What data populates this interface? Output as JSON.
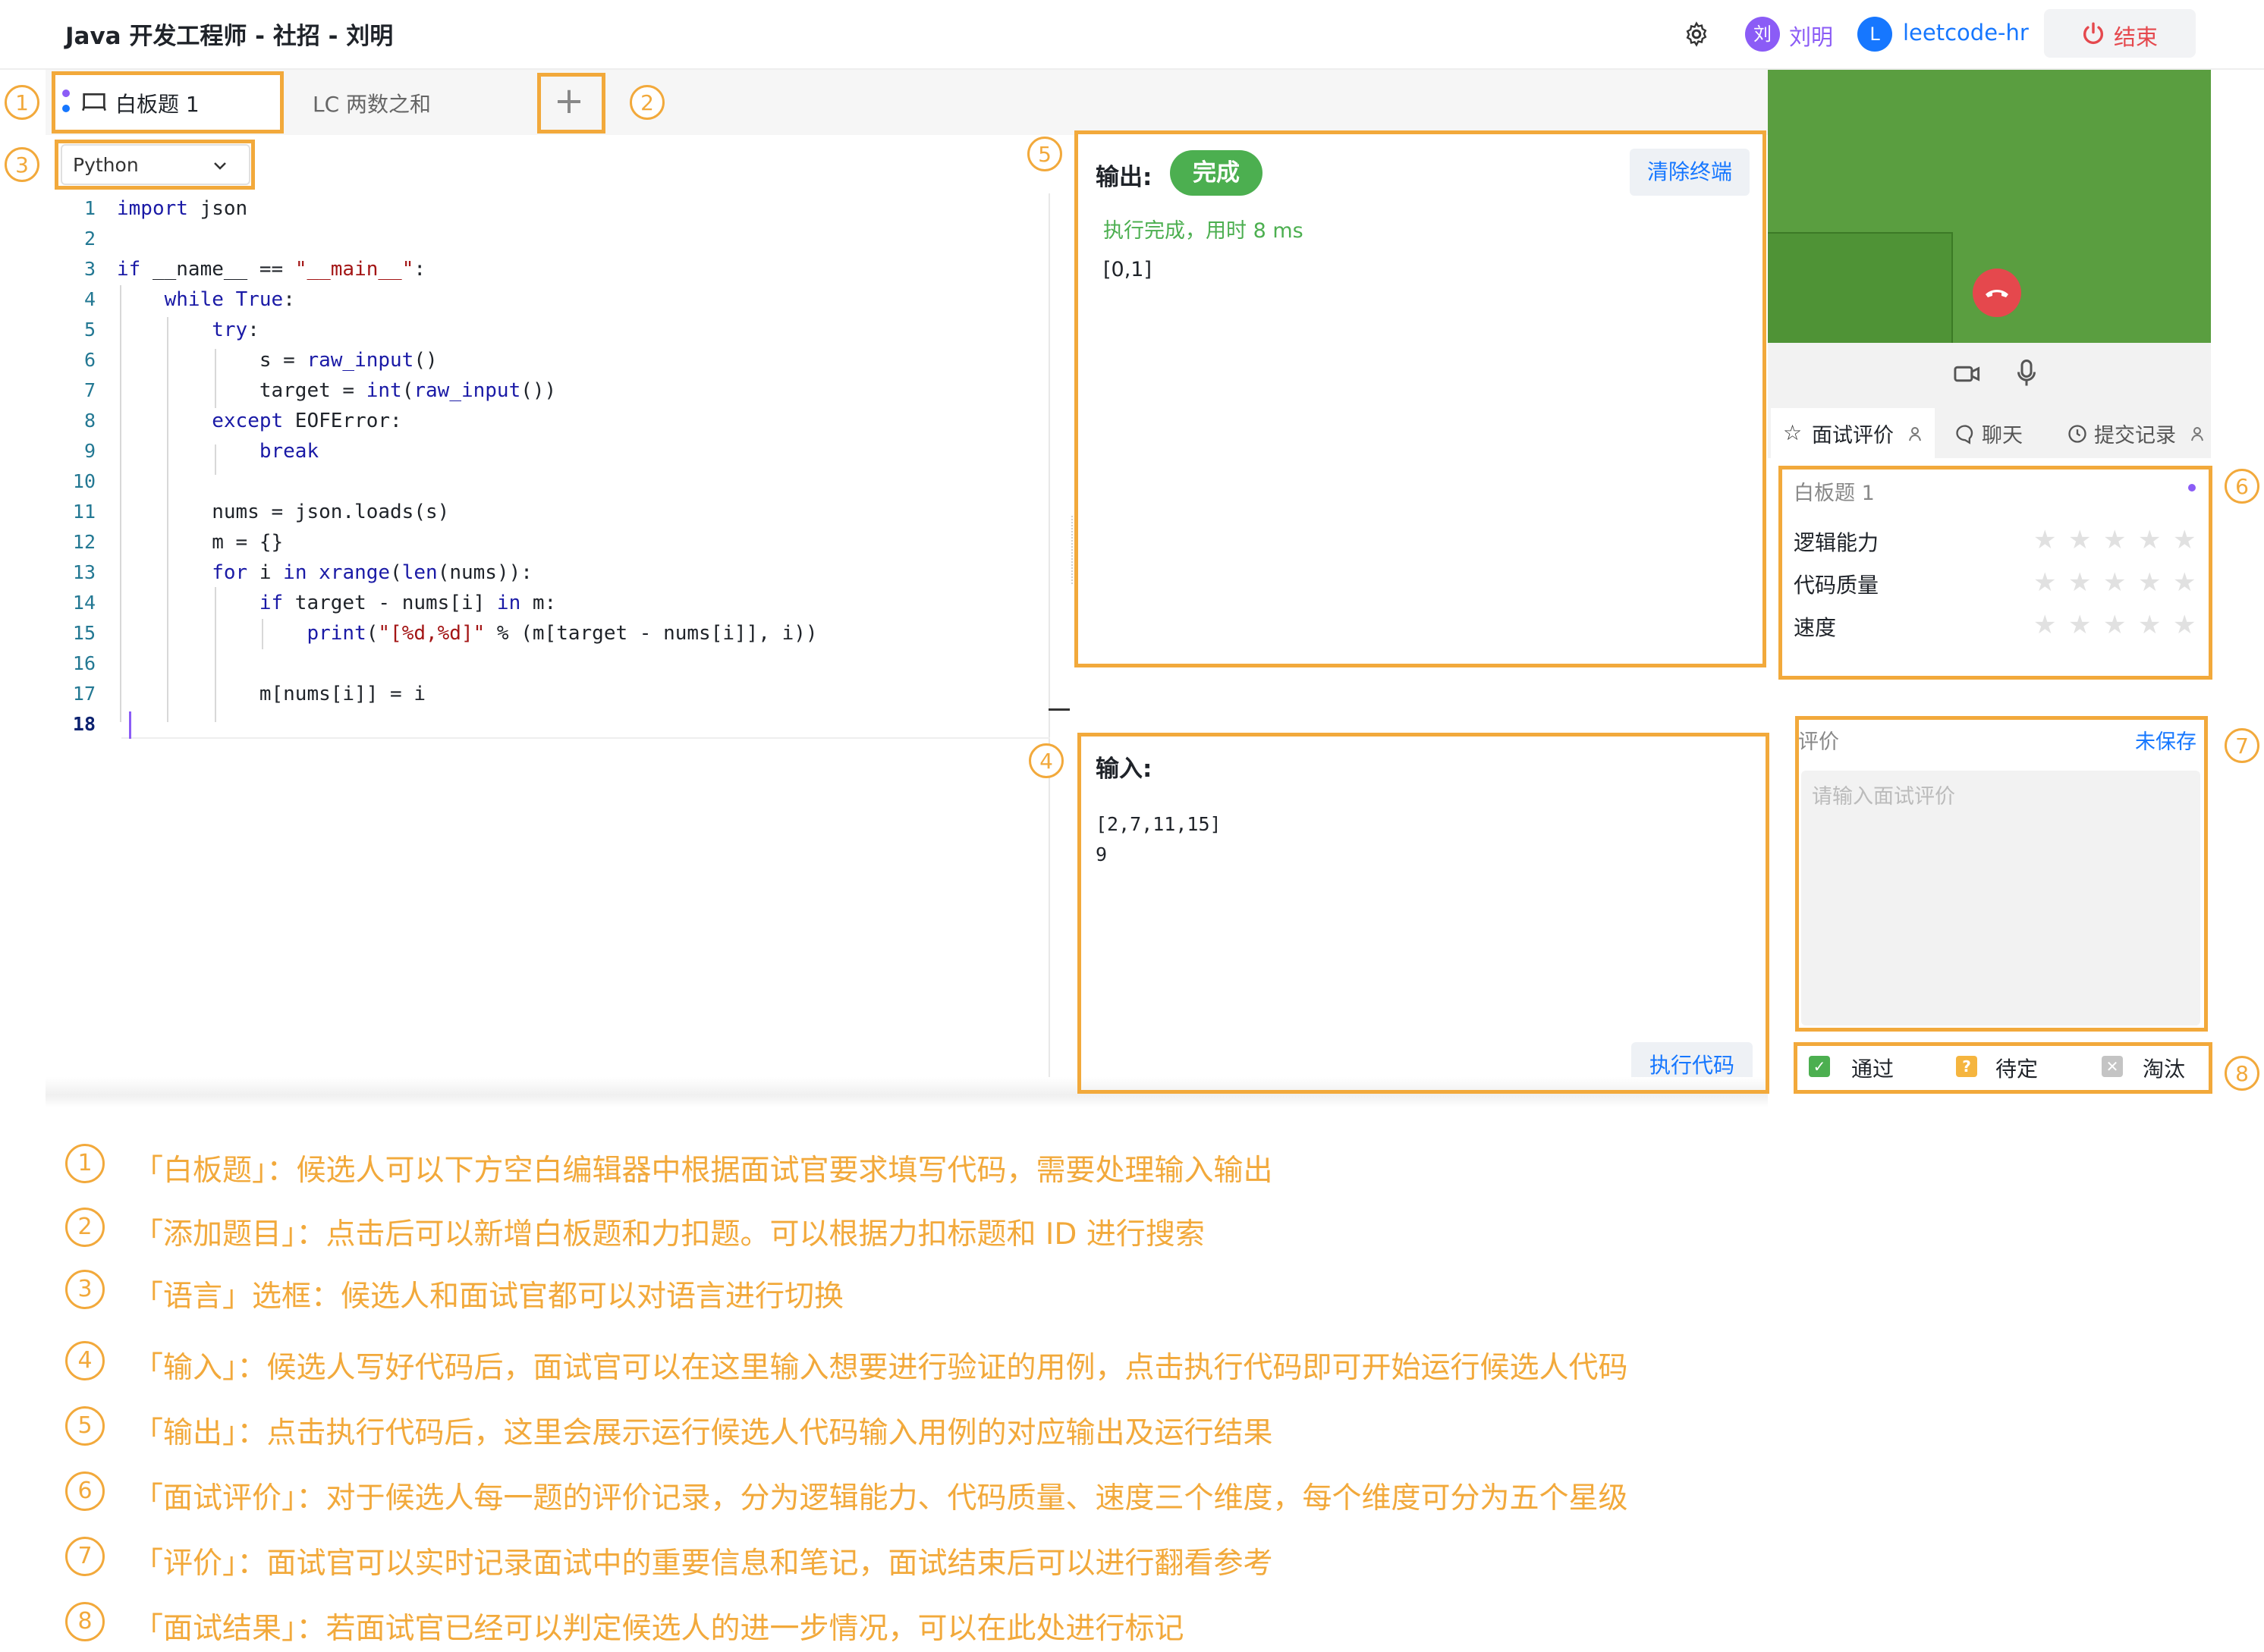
{
  "header": {
    "title": "Java 开发工程师 - 社招 - 刘明",
    "candidate_avatar": "刘",
    "candidate_name": "刘明",
    "hr_avatar": "L",
    "hr_name": "leetcode-hr",
    "end_label": "结束"
  },
  "tabs": [
    {
      "label": "白板题 1"
    },
    {
      "label": "LC 两数之和"
    }
  ],
  "add_tab": "+",
  "language": {
    "selected": "Python"
  },
  "editor": {
    "line_numbers": [
      "1",
      "2",
      "3",
      "4",
      "5",
      "6",
      "7",
      "8",
      "9",
      "10",
      "11",
      "12",
      "13",
      "14",
      "15",
      "16",
      "17",
      "18"
    ],
    "code": [
      "import json",
      "",
      "if __name__ == \"__main__\":",
      "    while True:",
      "        try:",
      "            s = raw_input()",
      "            target = int(raw_input())",
      "        except EOFError:",
      "            break",
      "",
      "        nums = json.loads(s)",
      "        m = {}",
      "        for i in xrange(len(nums)):",
      "            if target - nums[i] in m:",
      "                print(\"[%d,%d]\" % (m[target - nums[i]], i))",
      "",
      "            m[nums[i]] = i",
      ""
    ]
  },
  "output": {
    "label": "输出:",
    "status": "完成",
    "clear_label": "清除终端",
    "message": "执行完成，用时 8 ms",
    "result": "[0,1]"
  },
  "input": {
    "label": "输入:",
    "lines": [
      "[2,7,11,15]",
      "9"
    ],
    "run_label": "执行代码"
  },
  "side_tabs": {
    "evaluation": "面试评价",
    "chat": "聊天",
    "history": "提交记录"
  },
  "rating": {
    "title": "白板题 1",
    "criteria": [
      "逻辑能力",
      "代码质量",
      "速度"
    ],
    "max_stars": 5,
    "values": [
      0,
      0,
      0
    ]
  },
  "comment": {
    "label": "评价",
    "status": "未保存",
    "placeholder": "请输入面试评价"
  },
  "result": {
    "pass": "通过",
    "pending": "待定",
    "reject": "淘汰"
  },
  "markers": [
    "1",
    "2",
    "3",
    "4",
    "5",
    "6",
    "7",
    "8"
  ],
  "notes": [
    "「白板题」：候选人可以下方空白编辑器中根据面试官要求填写代码，需要处理输入输出",
    "「添加题目」：点击后可以新增白板题和力扣题。可以根据力扣标题和 ID 进行搜索",
    "「语言」选框：候选人和面试官都可以对语言进行切换",
    "「输入」：候选人写好代码后，面试官可以在这里输入想要进行验证的用例，点击执行代码即可开始运行候选人代码",
    "「输出」：点击执行代码后，这里会展示运行候选人代码输入用例的对应输出及运行结果",
    "「面试评价」：对于候选人每一题的评价记录，分为逻辑能力、代码质量、速度三个维度，每个维度可分为五个星级",
    "「评价」：面试官可以实时记录面试中的重要信息和笔记，面试结束后可以进行翻看参考",
    "「面试结果」：若面试官已经可以判定候选人的进一步情况，可以在此处进行标记"
  ],
  "colors": {
    "annotation": "#f2a93b",
    "video_bg": "#5a9e40",
    "success": "#4caf50",
    "link": "#1677ff",
    "danger": "#e5484d",
    "candidate": "#8b5cf6"
  }
}
